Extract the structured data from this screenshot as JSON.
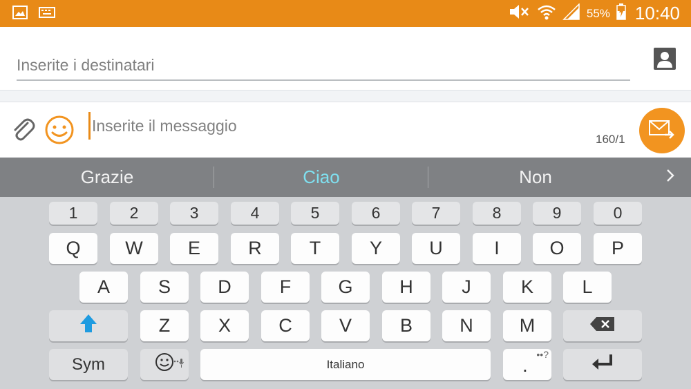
{
  "status_bar": {
    "battery_percent": "55%",
    "time": "10:40",
    "left_icons": [
      "gallery-icon",
      "keyboard-icon"
    ],
    "right_icons": [
      "mute-icon",
      "wifi-icon",
      "signal-icon",
      "battery-charging-icon"
    ]
  },
  "recipient": {
    "placeholder": "Inserite i destinatari",
    "value": ""
  },
  "composer": {
    "placeholder": "Inserite il messaggio",
    "value": "",
    "counter": "160/1"
  },
  "suggestions": [
    "Grazie",
    "Ciao",
    "Non"
  ],
  "keyboard": {
    "numbers": [
      "1",
      "2",
      "3",
      "4",
      "5",
      "6",
      "7",
      "8",
      "9",
      "0"
    ],
    "row1": [
      "Q",
      "W",
      "E",
      "R",
      "T",
      "Y",
      "U",
      "I",
      "O",
      "P"
    ],
    "row2": [
      "A",
      "S",
      "D",
      "F",
      "G",
      "H",
      "J",
      "K",
      "L"
    ],
    "row3": [
      "Z",
      "X",
      "C",
      "V",
      "B",
      "N",
      "M"
    ],
    "sym_label": "Sym",
    "space_label": "Italiano",
    "period_label": ".",
    "period_extra": "••?"
  },
  "colors": {
    "accent": "#e88a17",
    "send_button": "#f29420",
    "suggestion_highlight": "#7fe0f0",
    "shift_arrow": "#1e9be0"
  }
}
